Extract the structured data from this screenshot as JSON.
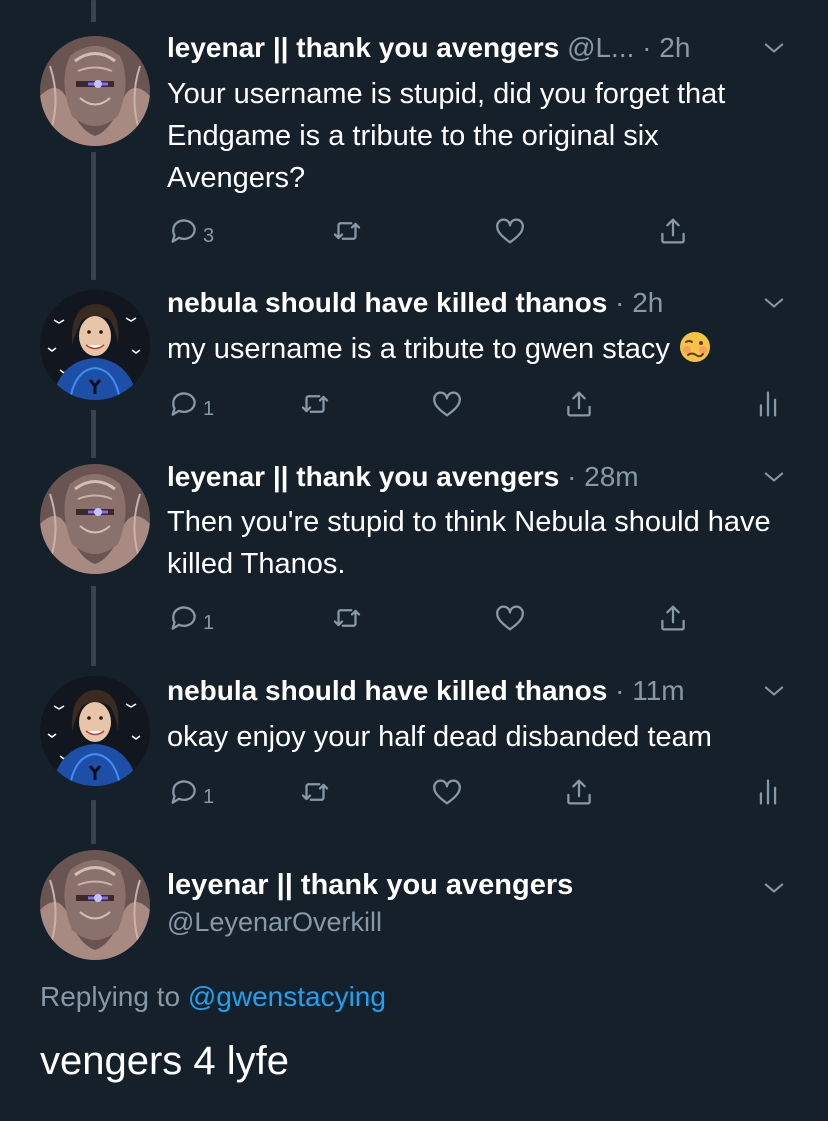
{
  "colors": {
    "background": "#15202b",
    "muted": "#8899a6",
    "link": "#1da1f2",
    "thread_line": "#38444d"
  },
  "tweets": [
    {
      "name": "leyenar || thank you avengers",
      "meta": "@L... · 2h",
      "text": "Your username is stupid, did you forget that Endgame is a tribute to the original six Avengers?",
      "reply_count": "3",
      "avatar": "thanos-art-avatar"
    },
    {
      "name": "nebula should have killed thanos",
      "meta": "· 2h",
      "text": "my username is a tribute to gwen stacy",
      "emoji": "woozy-face-emoji",
      "reply_count": "1",
      "avatar": "spider-gwen-avatar"
    },
    {
      "name": "leyenar || thank you avengers",
      "meta": "· 28m",
      "text": "Then you're stupid to think Nebula should have killed Thanos.",
      "reply_count": "1",
      "avatar": "thanos-art-avatar"
    },
    {
      "name": "nebula should have killed thanos",
      "meta": "· 11m",
      "text": "okay enjoy your half dead disbanded team",
      "reply_count": "1",
      "avatar": "spider-gwen-avatar"
    }
  ],
  "main_tweet": {
    "name": "leyenar || thank you avengers",
    "handle": "@LeyenarOverkill",
    "replying_prefix": "Replying to",
    "replying_to": "@gwenstacying",
    "text": "vengers 4 lyfe"
  },
  "icons": [
    "reply-icon",
    "retweet-icon",
    "like-icon",
    "share-icon",
    "analytics-icon",
    "chevron-down-icon"
  ]
}
